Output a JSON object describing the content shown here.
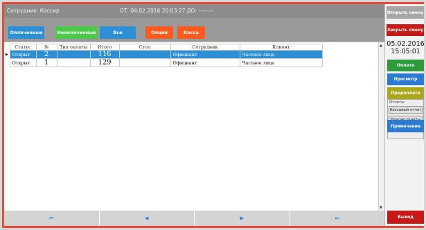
{
  "header": {
    "employee": "Сотрудник: Кассир",
    "period": "ОТ: 04.02.2016 20:03:27 ДО: --:--:--"
  },
  "tabs": [
    {
      "label": "Оплаченные",
      "color": "#2d8fd5"
    },
    {
      "label": "Неоплаченные",
      "color": "#4cc94c"
    },
    {
      "label": "Все",
      "color": "#2d8fd5"
    },
    {
      "label": "Опции",
      "color": "#ff5a1f"
    },
    {
      "label": "Касса",
      "color": "#ff5a1f"
    }
  ],
  "table": {
    "columns": [
      "Статус",
      "№",
      "Тип оплаты",
      "Итого",
      "Стол",
      "Сотрудник",
      "Клиент"
    ],
    "rows": [
      {
        "status": "Открыт",
        "num": "2",
        "payment_type": "",
        "total": "116",
        "table": "",
        "employee": "Официант",
        "client": "Частное лицо",
        "selected": true
      },
      {
        "status": "Открыт",
        "num": "1",
        "payment_type": "",
        "total": "129",
        "table": "",
        "employee": "Официант",
        "client": "Частное лицо",
        "selected": false
      }
    ]
  },
  "pager": {
    "first": "⏮",
    "prev": "◀",
    "next": "▶",
    "last": "⏭"
  },
  "sidebar": {
    "open_shift": "Открыть смену",
    "close_shift": "Закрыть смену",
    "date": "05.02.2016",
    "time": "15:05:01",
    "pay": "Оплата",
    "view": "Просмотр",
    "prepay": "Предоплата",
    "reports_label": "Отчеты",
    "x_report": "Кассовый отчет",
    "other_reports": "Другие отчеты",
    "note": "Примечание",
    "exit": "Выход"
  },
  "colors": {
    "accent_blue": "#2d8fd5",
    "green": "#2e9a3c",
    "olive": "#a8a81a",
    "red": "#c81919",
    "frame": "#e84a35"
  }
}
